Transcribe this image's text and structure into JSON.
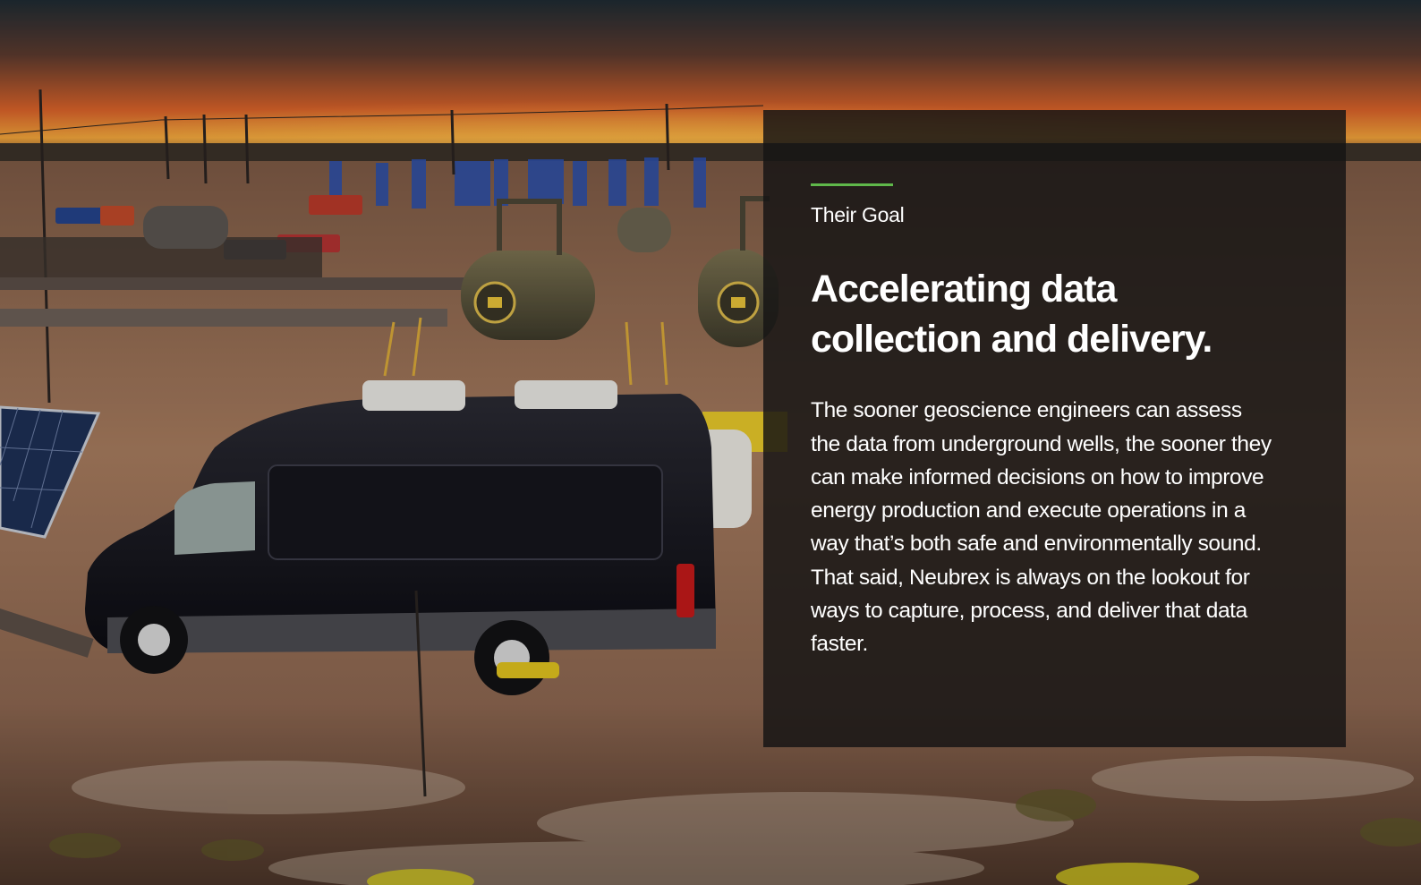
{
  "hero": {
    "eyebrow": "Their Goal",
    "headline": "Accelerating data collection and delivery.",
    "body": "The sooner geoscience engineers can assess the data from underground wells, the sooner they can make informed decisions on how to improve energy production and execute operations in a way that’s both safe and environmentally sound. That said, Neubrex is always on the lookout for ways to capture, process, and deliver that data faster."
  },
  "colors": {
    "accent": "#5fb84a",
    "panel": "#161414",
    "text": "#ffffff"
  }
}
